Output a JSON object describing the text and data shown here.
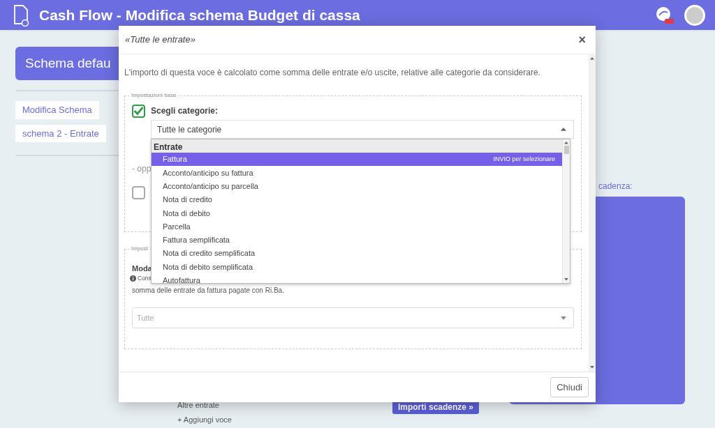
{
  "app_header": {
    "title": "Cash Flow - Modifica schema Budget di cassa"
  },
  "background": {
    "schema_button": "Schema defau",
    "menu_items": [
      "Modifica Schema",
      "schema 2 - Entrate"
    ],
    "section_label": "cadenza:",
    "list_items": [
      "Altre entrate",
      "+ Aggiungi voce"
    ],
    "importi_button": "Importi scadenze »"
  },
  "modal": {
    "title": "«Tutte le entrate»",
    "close": "×",
    "intro": "L'importo di questa voce è calcolato come somma delle entrate e/o uscite, relative alle categorie da considerare.",
    "base_settings": {
      "legend": "Impostazioni base",
      "choose": {
        "checked": true,
        "label": "Scegli categorie:",
        "value": "Tutte le categorie"
      },
      "dropdown": {
        "group": "Entrate",
        "hint": "INVIO per selezionare",
        "options": [
          {
            "label": "Fattura",
            "selected": true
          },
          {
            "label": "Acconto/anticipo su fattura",
            "selected": false
          },
          {
            "label": "Acconto/anticipo su parcella",
            "selected": false
          },
          {
            "label": "Nota di credito",
            "selected": false
          },
          {
            "label": "Nota di debito",
            "selected": false
          },
          {
            "label": "Parcella",
            "selected": false
          },
          {
            "label": "Fattura semplificata",
            "selected": false
          },
          {
            "label": "Nota di credito semplificata",
            "selected": false
          },
          {
            "label": "Nota di debito semplificata",
            "selected": false
          },
          {
            "label": "Autofattura",
            "selected": false
          }
        ]
      },
      "or_text": "- opp",
      "alt_checkbox": {
        "checked": false
      }
    },
    "other_settings": {
      "legend": "Impost",
      "heading": "Moda",
      "note": "Cons",
      "note_line2": "somma delle entrate da fattura pagate con Ri.Ba.",
      "select": {
        "placeholder": "Tutte"
      }
    },
    "close_button": "Chiudi"
  }
}
